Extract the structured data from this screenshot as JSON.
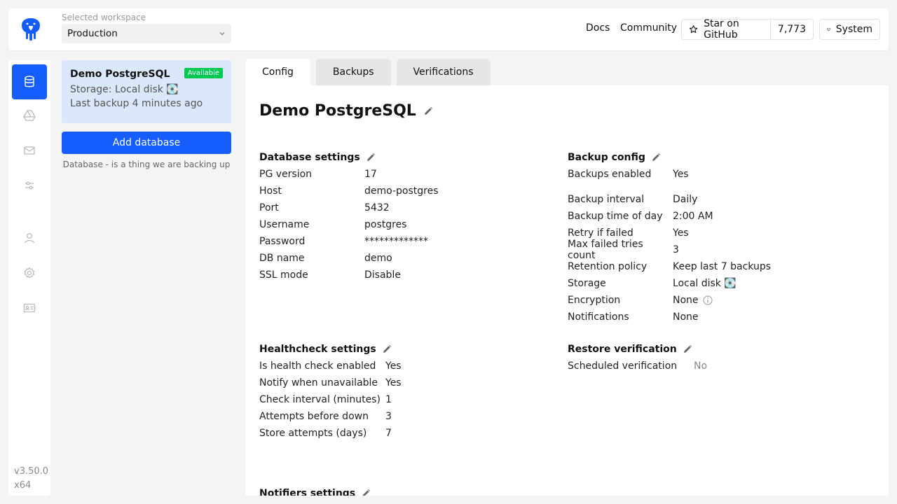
{
  "header": {
    "workspace_label": "Selected workspace",
    "workspace_value": "Production",
    "docs": "Docs",
    "community": "Community",
    "github_label": "Star on GitHub",
    "github_count": "7,773",
    "system_label": "System"
  },
  "rail": {
    "items": [
      "database-icon",
      "drive-icon",
      "mail-icon",
      "sliders-icon",
      "user-icon",
      "gear-icon",
      "id-card-icon"
    ],
    "version": "v3.50.0",
    "arch": "x64",
    "accent": "#155dfc"
  },
  "databases": {
    "card": {
      "name": "Demo PostgreSQL",
      "status": "Available",
      "storage": "Storage: Local disk 💽",
      "last_backup": "Last backup 4 minutes ago"
    },
    "add_label": "Add database",
    "hint": "Database - is a thing we are backing up"
  },
  "tabs": [
    "Config",
    "Backups",
    "Verifications"
  ],
  "main": {
    "title": "Demo PostgreSQL",
    "database_settings": {
      "title": "Database settings",
      "rows": [
        {
          "k": "PG version",
          "v": "17"
        },
        {
          "k": "Host",
          "v": "demo-postgres"
        },
        {
          "k": "Port",
          "v": "5432"
        },
        {
          "k": "Username",
          "v": "postgres"
        },
        {
          "k": "Password",
          "v": "*************"
        },
        {
          "k": "DB name",
          "v": "demo"
        },
        {
          "k": "SSL mode",
          "v": "Disable"
        }
      ]
    },
    "backup_config": {
      "title": "Backup config",
      "enabled": {
        "k": "Backups enabled",
        "v": "Yes"
      },
      "rows": [
        {
          "k": "Backup interval",
          "v": "Daily"
        },
        {
          "k": "Backup time of day",
          "v": "2:00 AM"
        },
        {
          "k": "Retry if failed",
          "v": "Yes"
        },
        {
          "k": "Max failed tries count",
          "v": "3"
        },
        {
          "k": "Retention policy",
          "v": "Keep last 7 backups"
        },
        {
          "k": "Storage",
          "v": "Local disk 💽"
        },
        {
          "k": "Encryption",
          "v": "None"
        },
        {
          "k": "Notifications",
          "v": "None"
        }
      ]
    },
    "healthcheck": {
      "title": "Healthcheck settings",
      "rows": [
        {
          "k": "Is health check enabled",
          "v": "Yes"
        },
        {
          "k": "Notify when unavailable",
          "v": "Yes"
        },
        {
          "k": "Check interval (minutes)",
          "v": "1"
        },
        {
          "k": "Attempts before down",
          "v": "3"
        },
        {
          "k": "Store attempts (days)",
          "v": "7"
        }
      ]
    },
    "restore_verification": {
      "title": "Restore verification",
      "rows": [
        {
          "k": "Scheduled verification",
          "v": "No"
        }
      ]
    },
    "notifiers": {
      "title": "Notifiers settings"
    }
  }
}
